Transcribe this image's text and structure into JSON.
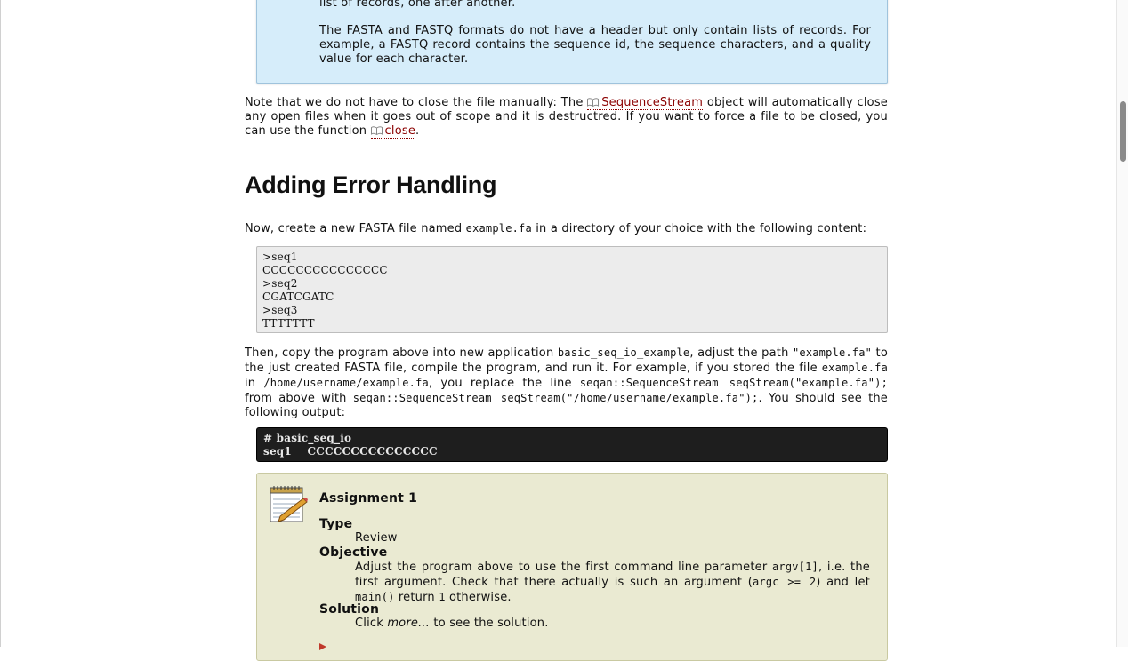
{
  "note_box": {
    "line_top": "list of records, one after another.",
    "paragraph": "The FASTA and FASTQ formats do not have a header but only contain lists of records. For example, a FASTQ record contains the sequence id, the sequence characters, and a quality value for each character."
  },
  "close_note": {
    "part1": "Note that we do not have to close the file manually: The ",
    "link1": "SequenceStream",
    "part2": " object will automatically close any open files when it goes out of scope and it is destructred. If you want to force a file to be closed, you can use the function ",
    "link2": "close",
    "part3": "."
  },
  "section_heading": "Adding Error Handling",
  "create_file": {
    "part1": "Now, create a new FASTA file named ",
    "code1": "example.fa",
    "part2": " in a directory of your choice with the following content:"
  },
  "fasta_content": [
    ">seq1",
    "CCCCCCCCCCCCCCC",
    ">seq2",
    "CGATCGATC",
    ">seq3",
    "TTTTTTT"
  ],
  "copy_program": {
    "part1": "Then, copy the program above into new application ",
    "code1": "basic_seq_io_example",
    "part2": ", adjust the path ",
    "code2": "\"example.fa\"",
    "part3": " to the just created FASTA file, compile the program, and run it. For example, if you stored the file ",
    "code3": "example.fa",
    "part4": " in ",
    "code4": "/home/username/example.fa",
    "part5": ", you replace the line ",
    "code5": "seqan::SequenceStream seqStream(\"example.fa\");",
    "part6": " from above with ",
    "code6": "seqan::SequenceStream seqStream(\"/home/username/example.fa\");",
    "part7": ". You should see the following output:"
  },
  "shell_output": [
    "# basic_seq_io",
    "seq1    CCCCCCCCCCCCCCC"
  ],
  "assignment": {
    "title": "Assignment 1",
    "type_label": "Type",
    "type_value": "Review",
    "objective_label": "Objective",
    "objective_part1": "Adjust the program above to use the first command line parameter ",
    "objective_code1": "argv[1]",
    "objective_part2": ", i.e. the first argument. Check that there actually is such an argument (",
    "objective_code2": "argc >= 2",
    "objective_part3": ") and let ",
    "objective_code3": "main()",
    "objective_part4": " return ",
    "objective_code4": "1",
    "objective_part5": " otherwise.",
    "solution_label": "Solution",
    "solution_part1": "Click ",
    "solution_more": "more...",
    "solution_part2": " to see the solution."
  },
  "icons": {
    "link_icon": "book-icon",
    "assignment_icon": "notepad-pencil-icon"
  },
  "colors": {
    "link": "#8b0000",
    "note_bg": "#d6edfa",
    "assignment_bg": "#eaead2",
    "shell_bg": "#1e1e1e"
  }
}
